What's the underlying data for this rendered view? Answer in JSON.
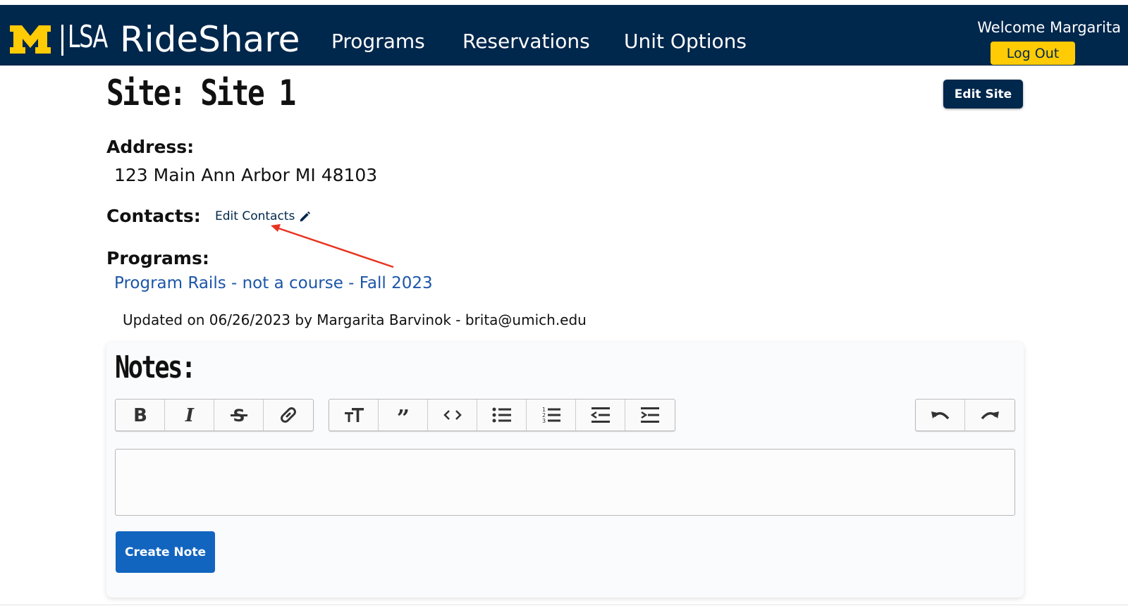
{
  "header": {
    "logo_text": "LSA",
    "app_title": "RideShare",
    "nav": [
      "Programs",
      "Reservations",
      "Unit Options"
    ],
    "welcome": "Welcome Margarita",
    "logout_label": "Log Out",
    "brand_colors": {
      "navy": "#00274c",
      "maize": "#ffcb05"
    }
  },
  "site": {
    "title": "Site: Site 1",
    "edit_label": "Edit Site",
    "address_label": "Address:",
    "address": "123 Main Ann Arbor MI 48103",
    "contacts_label": "Contacts:",
    "edit_contacts_label": "Edit Contacts",
    "programs_label": "Programs:",
    "program_link": "Program Rails - not a course - Fall 2023",
    "updated": "Updated on 06/26/2023 by Margarita Barvinok - brita@umich.edu"
  },
  "notes": {
    "title": "Notes:",
    "toolbar_groups": [
      [
        "bold-icon",
        "italic-icon",
        "strikethrough-icon",
        "link-icon"
      ],
      [
        "heading-icon",
        "quote-icon",
        "code-icon",
        "bullet-list-icon",
        "numbered-list-icon",
        "outdent-icon",
        "indent-icon"
      ],
      [
        "undo-icon",
        "redo-icon"
      ]
    ],
    "editor_value": "",
    "create_label": "Create Note"
  }
}
